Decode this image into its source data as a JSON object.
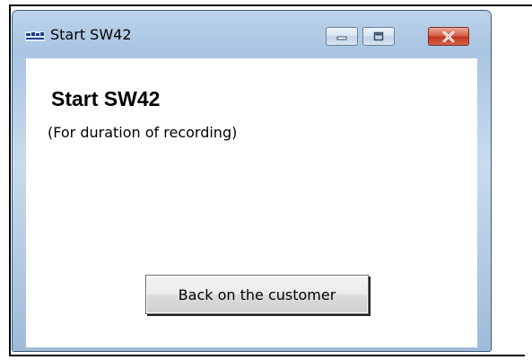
{
  "window": {
    "title": "Start SW42",
    "controls": {
      "minimize": "minimize-icon",
      "maximize": "maximize-icon",
      "close": "close-icon"
    }
  },
  "content": {
    "heading": "Start SW42",
    "subtext": "(For duration of recording)",
    "button_label": "Back on the customer"
  },
  "colors": {
    "close_button": "#c2351e",
    "title_frame": "#a9c4e2"
  }
}
